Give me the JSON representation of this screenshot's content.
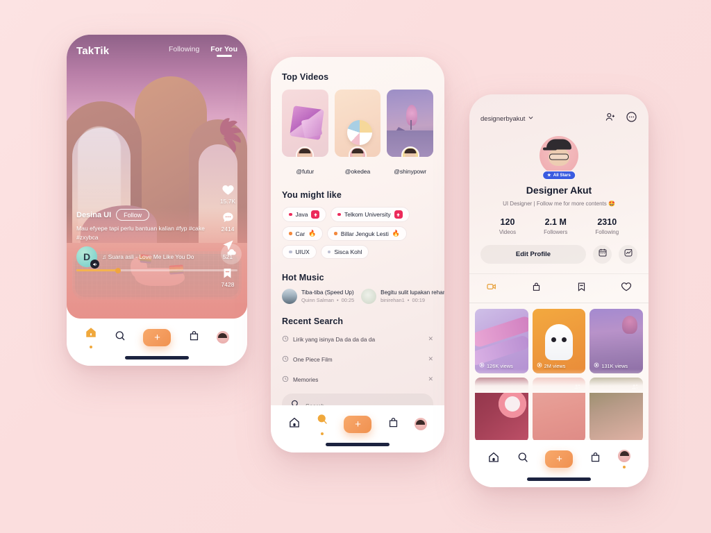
{
  "canvas": {
    "background": "#fbdede"
  },
  "phone1": {
    "brand": "TakTik",
    "tabs": [
      {
        "label": "Following",
        "active": false
      },
      {
        "label": "For You",
        "active": true
      }
    ],
    "actions": [
      {
        "icon": "heart-icon",
        "count": "15.7K"
      },
      {
        "icon": "comment-icon",
        "count": "2414"
      },
      {
        "icon": "share-icon",
        "count": "521"
      },
      {
        "icon": "bookmark-icon",
        "count": "7428"
      }
    ],
    "post": {
      "username": "Desina UI",
      "follow_label": "Follow",
      "caption": "Mau efyepe tapi perlu bantuan kalian #fyp #cake #zxybca",
      "music": "♫ Suara asli - Love Me Like You Do",
      "avatar_initial": "D",
      "progress_percent": 26
    },
    "nav": [
      {
        "icon": "home-icon",
        "active": true
      },
      {
        "icon": "search-icon",
        "active": false
      },
      {
        "icon": "plus-icon",
        "label": "+",
        "active": false
      },
      {
        "icon": "inbox-icon",
        "active": false
      },
      {
        "icon": "profile-avatar-icon",
        "active": false
      }
    ]
  },
  "phone2": {
    "top_videos": {
      "title": "Top Videos",
      "items": [
        {
          "handle": "@futur"
        },
        {
          "handle": "@okedea"
        },
        {
          "handle": "@shinypowr"
        }
      ]
    },
    "you_might_like": {
      "title": "You might like",
      "tags": [
        {
          "label": "Java",
          "dot": "#ec2a5a",
          "badge": "arrow-up-badge",
          "emoji": ""
        },
        {
          "label": "Telkom University",
          "dot": "#ec2a5a",
          "badge": "arrow-up-badge",
          "emoji": ""
        },
        {
          "label": "Car",
          "dot": "#f2883c",
          "badge": "",
          "emoji": "🔥"
        },
        {
          "label": "Billar Jenguk Lesti",
          "dot": "#f2883c",
          "badge": "",
          "emoji": "🔥"
        },
        {
          "label": "UIUX",
          "dot": "#b9bcd0",
          "badge": "",
          "emoji": ""
        },
        {
          "label": "Sisca Kohl",
          "dot": "#b9bcd0",
          "badge": "",
          "emoji": ""
        }
      ]
    },
    "hot_music": {
      "title": "Hot Music",
      "items": [
        {
          "title": "Tiba-tiba (Speed Up)",
          "artist": "Quinn Salman",
          "duration": "00:25"
        },
        {
          "title": "Begitu sulit lupakan rehan",
          "artist": "binirehan1",
          "duration": "00:19"
        }
      ]
    },
    "recent_search": {
      "title": "Recent Search",
      "items": [
        {
          "text": "Lirik yang isinya Da da da da da"
        },
        {
          "text": "One Piece Film"
        },
        {
          "text": "Memories"
        }
      ],
      "clear_label": "✕"
    },
    "search": {
      "placeholder": "Search",
      "value": ""
    },
    "nav": [
      {
        "icon": "home-icon",
        "active": false
      },
      {
        "icon": "search-icon",
        "active": true
      },
      {
        "icon": "plus-icon",
        "label": "+",
        "active": false
      },
      {
        "icon": "inbox-icon",
        "active": false
      },
      {
        "icon": "profile-avatar-icon",
        "active": false
      }
    ]
  },
  "phone3": {
    "header": {
      "username": "designerbyakut"
    },
    "profile": {
      "badge": "All Stars",
      "name": "Designer Akut",
      "bio": "UI Designer | Follow me for more contents 🤩"
    },
    "stats": [
      {
        "value": "120",
        "label": "Videos"
      },
      {
        "value": "2.1 M",
        "label": "Followers"
      },
      {
        "value": "2310",
        "label": "Following"
      }
    ],
    "actions": {
      "edit_label": "Edit Profile",
      "calendar_icon": "calendar-icon",
      "analytics_icon": "analytics-icon"
    },
    "tabs": [
      {
        "icon": "video-icon",
        "active": true
      },
      {
        "icon": "lock-icon",
        "active": false
      },
      {
        "icon": "bookmark-icon",
        "active": false
      },
      {
        "icon": "heart-icon",
        "active": false
      }
    ],
    "grid": [
      {
        "views": "126K views",
        "group": false
      },
      {
        "views": "2M views",
        "group": false
      },
      {
        "views": "131K views",
        "group": false
      },
      {
        "views": "",
        "group": false
      },
      {
        "views": "",
        "group": true
      },
      {
        "views": "",
        "group": true
      }
    ],
    "nav": [
      {
        "icon": "home-icon",
        "active": false
      },
      {
        "icon": "search-icon",
        "active": false
      },
      {
        "icon": "plus-icon",
        "label": "+",
        "active": false
      },
      {
        "icon": "inbox-icon",
        "active": false
      },
      {
        "icon": "profile-avatar-icon",
        "active": true
      }
    ]
  }
}
